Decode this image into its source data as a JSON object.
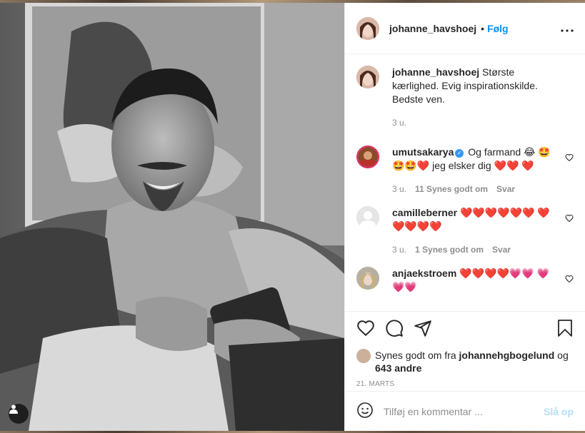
{
  "post": {
    "author": "johanne_havshoej",
    "follow_label": "Følg",
    "separator": "•",
    "more_label": "•••"
  },
  "caption": {
    "username": "johanne_havshoej",
    "text": "Største kærlighed. Evig inspirationskilde. Bedste ven.",
    "age": "3 u."
  },
  "comments": [
    {
      "username": "umutsakarya",
      "verified": true,
      "text": "Og farmand 😂 🤩🤩🤩❤️ jeg elsker dig ❤️❤️ ❤️",
      "age": "3 u.",
      "likes": "11 Synes godt om",
      "reply": "Svar"
    },
    {
      "username": "camilleberner",
      "text": "❤️❤️❤️❤️❤️❤️ ❤️❤️❤️❤️❤️",
      "age": "3 u.",
      "likes": "1 Synes godt om",
      "reply": "Svar"
    },
    {
      "username": "anjaekstroem",
      "text": "❤️❤️❤️❤️💗💗 💗💗💗"
    }
  ],
  "likes_line": {
    "prefix": "Synes godt om fra",
    "user": "johannehgbogelund",
    "suffix": "og",
    "others": "643 andre"
  },
  "date": "21. MARTS",
  "composer": {
    "placeholder": "Tilføj en kommentar ...",
    "post_label": "Slå op"
  },
  "colors": {
    "accent": "#0095f6",
    "post_disabled": "#b2dffc",
    "heart": "#e0245e"
  }
}
